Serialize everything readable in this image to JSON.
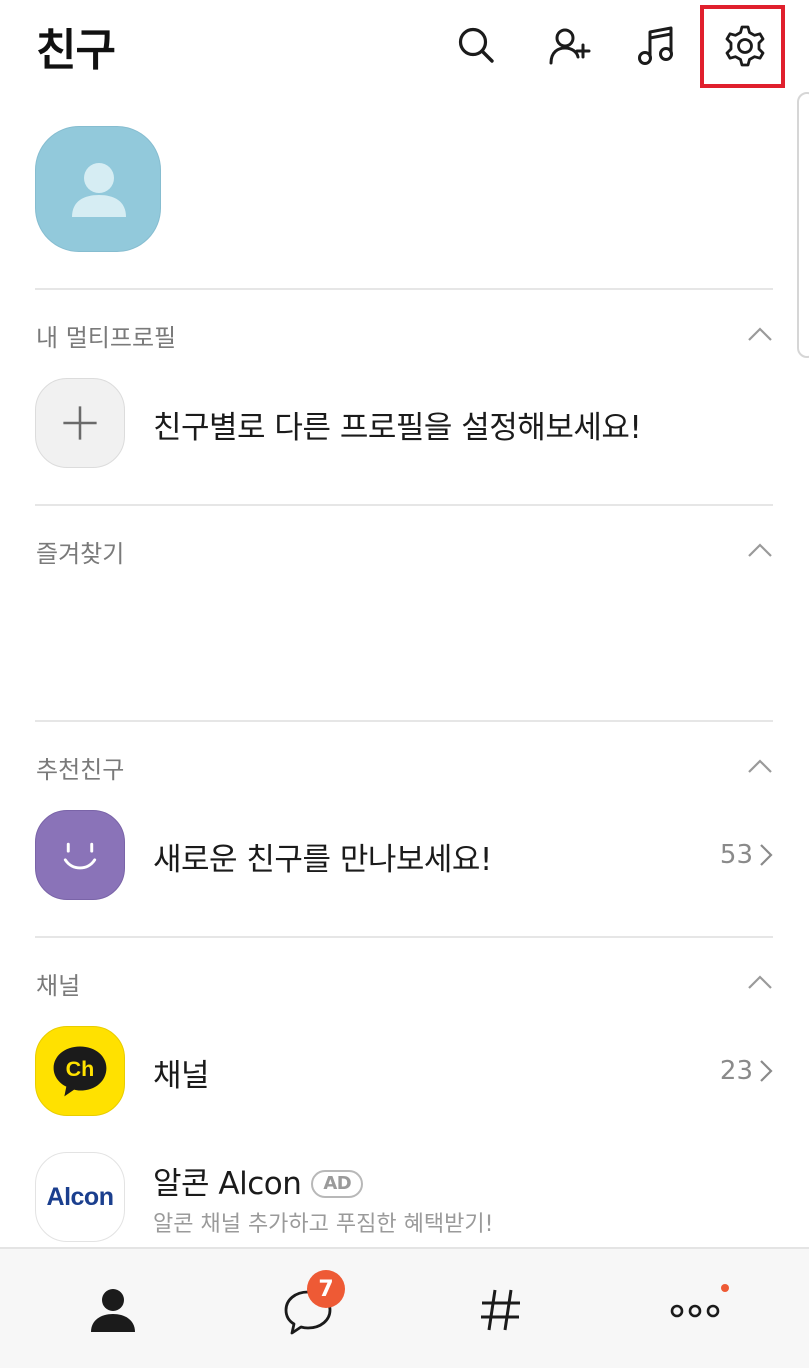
{
  "header": {
    "title": "친구",
    "icons": [
      "search-icon",
      "add-friend-icon",
      "music-icon",
      "settings-icon"
    ]
  },
  "sections": {
    "multi_profile": {
      "title": "내 멀티프로필",
      "prompt": "친구별로 다른 프로필을 설정해보세요!"
    },
    "favorites": {
      "title": "즐겨찾기"
    },
    "recommended": {
      "title": "추천친구",
      "item_label": "새로운 친구를 만나보세요!",
      "count": "53"
    },
    "channel": {
      "title": "채널",
      "channel_item": {
        "label": "채널",
        "count": "23",
        "logo_text": "Ch"
      },
      "ad_item": {
        "name": "알콘 Alcon",
        "badge": "AD",
        "subtitle": "알콘 채널 추가하고 푸짐한 혜택받기!",
        "logo_text": "Alcon"
      }
    }
  },
  "tabbar": {
    "tabs": [
      "friends-icon",
      "chat-icon",
      "hashtag-icon",
      "more-icon"
    ],
    "chat_unread": "7"
  },
  "colors": {
    "accent_badge": "#ee5a35",
    "highlight_box": "#e0202d",
    "profile_bg": "#92c9db",
    "smile_bg": "#8a73b8",
    "channel_yellow": "#ffe100",
    "alcon_blue": "#1b3f8e"
  }
}
